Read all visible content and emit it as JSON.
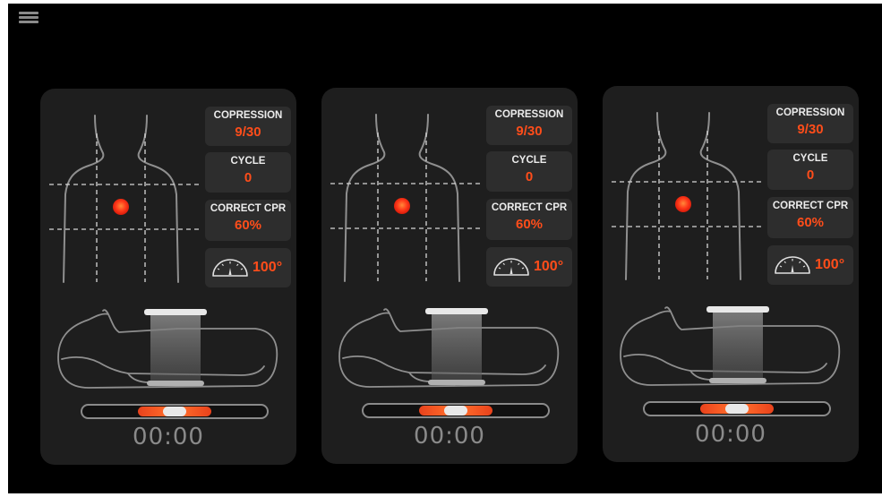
{
  "app": {
    "menu_icon": "hamburger-menu-icon"
  },
  "colors": {
    "background": "#000000",
    "panel": "#1e1e1e",
    "stat_box": "#2d2d2d",
    "accent": "#ff4d1a",
    "outline": "#8a8a8a"
  },
  "panels": [
    {
      "compression": {
        "label": "COPRESSION",
        "value": "9/30"
      },
      "cycle": {
        "label": "CYCLE",
        "value": "0"
      },
      "correct_cpr": {
        "label": "CORRECT CPR",
        "value": "60%"
      },
      "angle": {
        "icon": "speedometer-icon",
        "value": "100°"
      },
      "depth_level": 0.5,
      "timer": "00:00"
    },
    {
      "compression": {
        "label": "COPRESSION",
        "value": "9/30"
      },
      "cycle": {
        "label": "CYCLE",
        "value": "0"
      },
      "correct_cpr": {
        "label": "CORRECT CPR",
        "value": "60%"
      },
      "angle": {
        "icon": "speedometer-icon",
        "value": "100°"
      },
      "depth_level": 0.5,
      "timer": "00:00"
    },
    {
      "compression": {
        "label": "COPRESSION",
        "value": "9/30"
      },
      "cycle": {
        "label": "CYCLE",
        "value": "0"
      },
      "correct_cpr": {
        "label": "CORRECT CPR",
        "value": "60%"
      },
      "angle": {
        "icon": "speedometer-icon",
        "value": "100°"
      },
      "depth_level": 0.5,
      "timer": "00:00"
    }
  ]
}
